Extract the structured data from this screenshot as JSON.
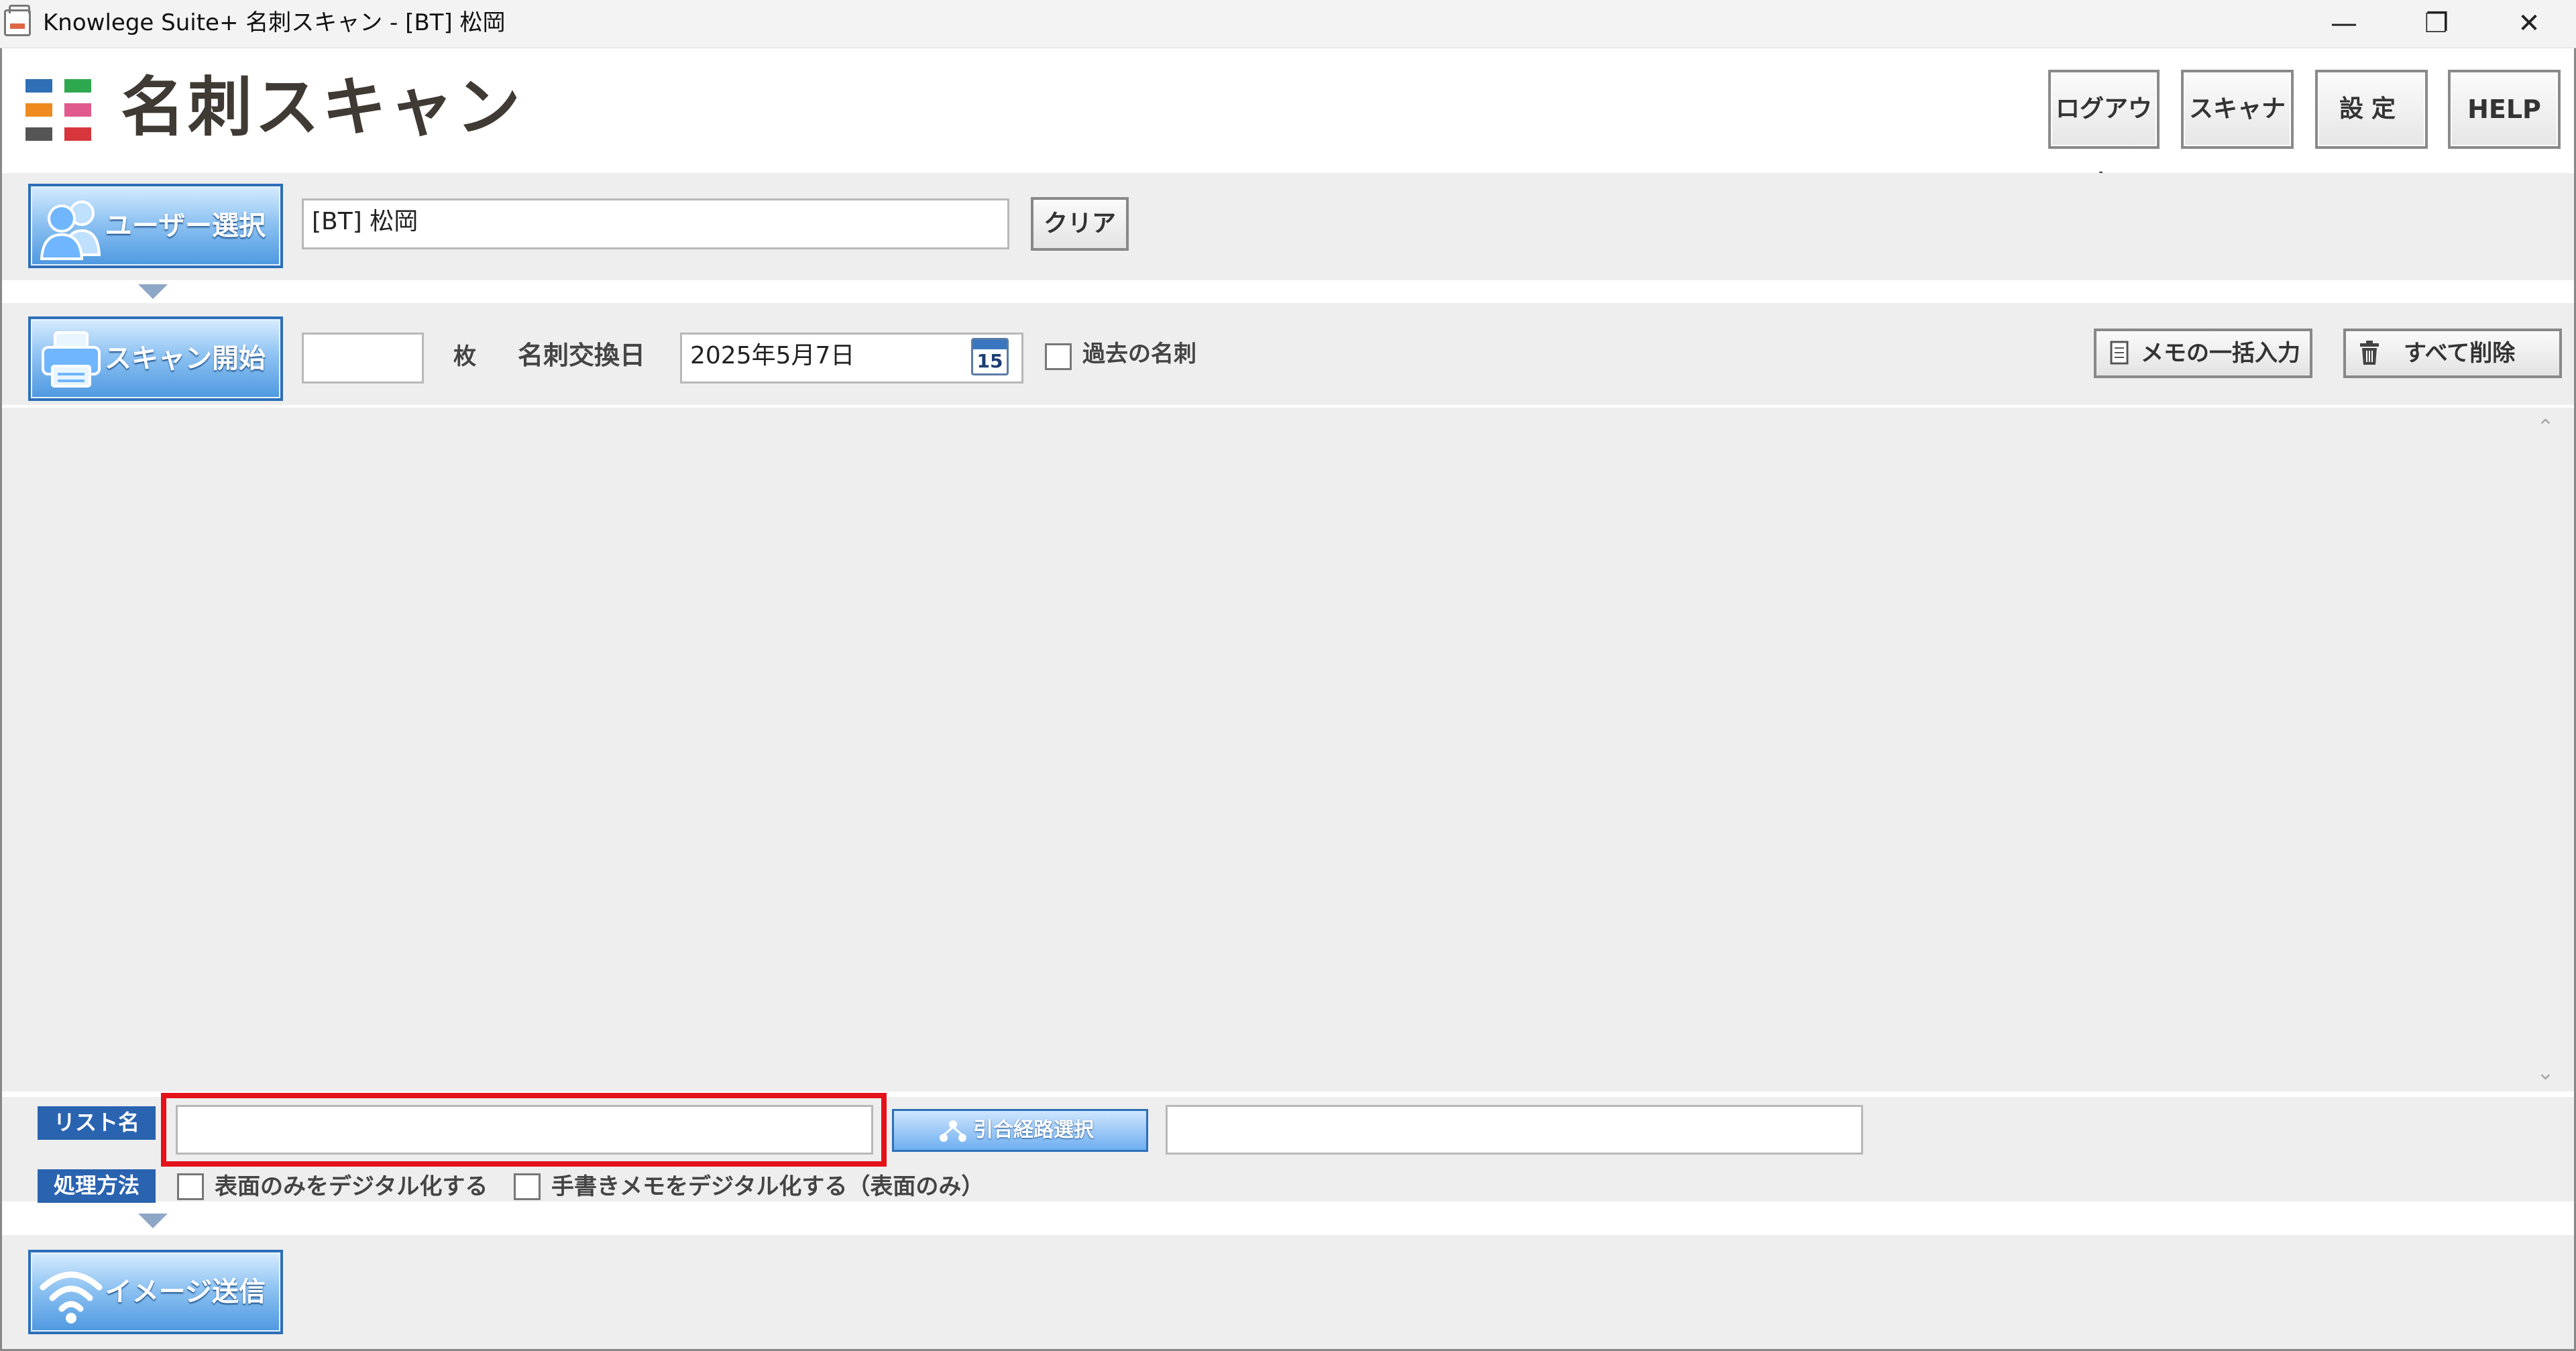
{
  "window": {
    "title": "Knowlege Suite+ 名刺スキャン - [BT] 松岡",
    "minimize_glyph": "—",
    "restore_glyph": "❐",
    "close_glyph": "✕"
  },
  "header": {
    "app_title": "名刺スキャン",
    "logo_colors": [
      "#2f6fb6",
      "#2ea84f",
      "#ef8a1f",
      "#e15a8e",
      "#555555",
      "#d6363c"
    ],
    "buttons": {
      "logout": "ログアウト",
      "scanner": "スキャナ",
      "settings": "設定",
      "help": "HELP"
    }
  },
  "user_panel": {
    "select_button": "ユーザー選択",
    "user_name": "[BT] 松岡",
    "clear_button": "クリア"
  },
  "scan_panel": {
    "start_button": "スキャン開始",
    "count_value": "",
    "count_unit": "枚",
    "exchange_date_label": "名刺交換日",
    "exchange_date_value": "2025年5月7日",
    "calendar_day": "15",
    "past_cards_label": "過去の名刺",
    "past_cards_checked": false,
    "memo_bulk_button": "メモの一括入力",
    "delete_all_button": "すべて削除"
  },
  "bottom_panel": {
    "list_name_tag": "リスト名",
    "list_name_value": "",
    "referral_route_button": "引合経路選択",
    "referral_route_value": "",
    "process_method_tag": "処理方法",
    "front_only_label": "表面のみをデジタル化する",
    "handwritten_memo_label": "手書きメモをデジタル化する（表面のみ）"
  },
  "send_panel": {
    "send_button": "イメージ送信"
  },
  "colors": {
    "accent_blue": "#2a63b0",
    "highlight_red": "#e3121b",
    "panel_gray": "#eeeeee"
  }
}
